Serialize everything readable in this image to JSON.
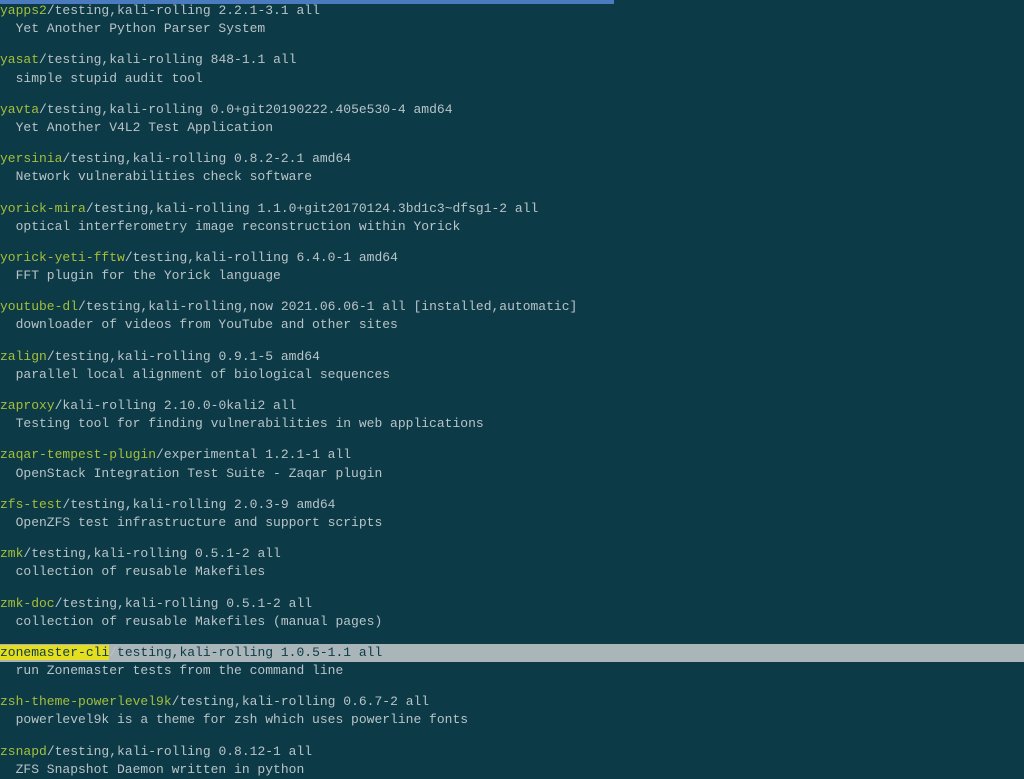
{
  "scrollbar": {
    "thumbWidthPercent": 60
  },
  "packages": [
    {
      "name": "yapps2",
      "meta": "testing,kali-rolling 2.2.1-3.1 all",
      "desc": "Yet Another Python Parser System",
      "highlighted": false
    },
    {
      "name": "yasat",
      "meta": "testing,kali-rolling 848-1.1 all",
      "desc": "simple stupid audit tool",
      "highlighted": false
    },
    {
      "name": "yavta",
      "meta": "testing,kali-rolling 0.0+git20190222.405e530-4 amd64",
      "desc": "Yet Another V4L2 Test Application",
      "highlighted": false
    },
    {
      "name": "yersinia",
      "meta": "testing,kali-rolling 0.8.2-2.1 amd64",
      "desc": "Network vulnerabilities check software",
      "highlighted": false
    },
    {
      "name": "yorick-mira",
      "meta": "testing,kali-rolling 1.1.0+git20170124.3bd1c3~dfsg1-2 all",
      "desc": "optical interferometry image reconstruction within Yorick",
      "highlighted": false
    },
    {
      "name": "yorick-yeti-fftw",
      "meta": "testing,kali-rolling 6.4.0-1 amd64",
      "desc": "FFT plugin for the Yorick language",
      "highlighted": false
    },
    {
      "name": "youtube-dl",
      "meta": "testing,kali-rolling,now 2021.06.06-1 all [installed,automatic]",
      "desc": "downloader of videos from YouTube and other sites",
      "highlighted": false
    },
    {
      "name": "zalign",
      "meta": "testing,kali-rolling 0.9.1-5 amd64",
      "desc": "parallel local alignment of biological sequences",
      "highlighted": false
    },
    {
      "name": "zaproxy",
      "meta": "kali-rolling 2.10.0-0kali2 all",
      "desc": "Testing tool for finding vulnerabilities in web applications",
      "highlighted": false
    },
    {
      "name": "zaqar-tempest-plugin",
      "meta": "experimental 1.2.1-1 all",
      "desc": "OpenStack Integration Test Suite - Zaqar plugin",
      "highlighted": false
    },
    {
      "name": "zfs-test",
      "meta": "testing,kali-rolling 2.0.3-9 amd64",
      "desc": "OpenZFS test infrastructure and support scripts",
      "highlighted": false
    },
    {
      "name": "zmk",
      "meta": "testing,kali-rolling 0.5.1-2 all",
      "desc": "collection of reusable Makefiles",
      "highlighted": false
    },
    {
      "name": "zmk-doc",
      "meta": "testing,kali-rolling 0.5.1-2 all",
      "desc": "collection of reusable Makefiles (manual pages)",
      "highlighted": false
    },
    {
      "name": "zonemaster-cli",
      "meta": "testing,kali-rolling 1.0.5-1.1 all",
      "desc": "run Zonemaster tests from the command line",
      "highlighted": true
    },
    {
      "name": "zsh-theme-powerlevel9k",
      "meta": "testing,kali-rolling 0.6.7-2 all",
      "desc": "powerlevel9k is a theme for zsh which uses powerline fonts",
      "highlighted": false
    },
    {
      "name": "zsnapd",
      "meta": "testing,kali-rolling 0.8.12-1 all",
      "desc": "ZFS Snapshot Daemon written in python",
      "highlighted": false
    }
  ]
}
